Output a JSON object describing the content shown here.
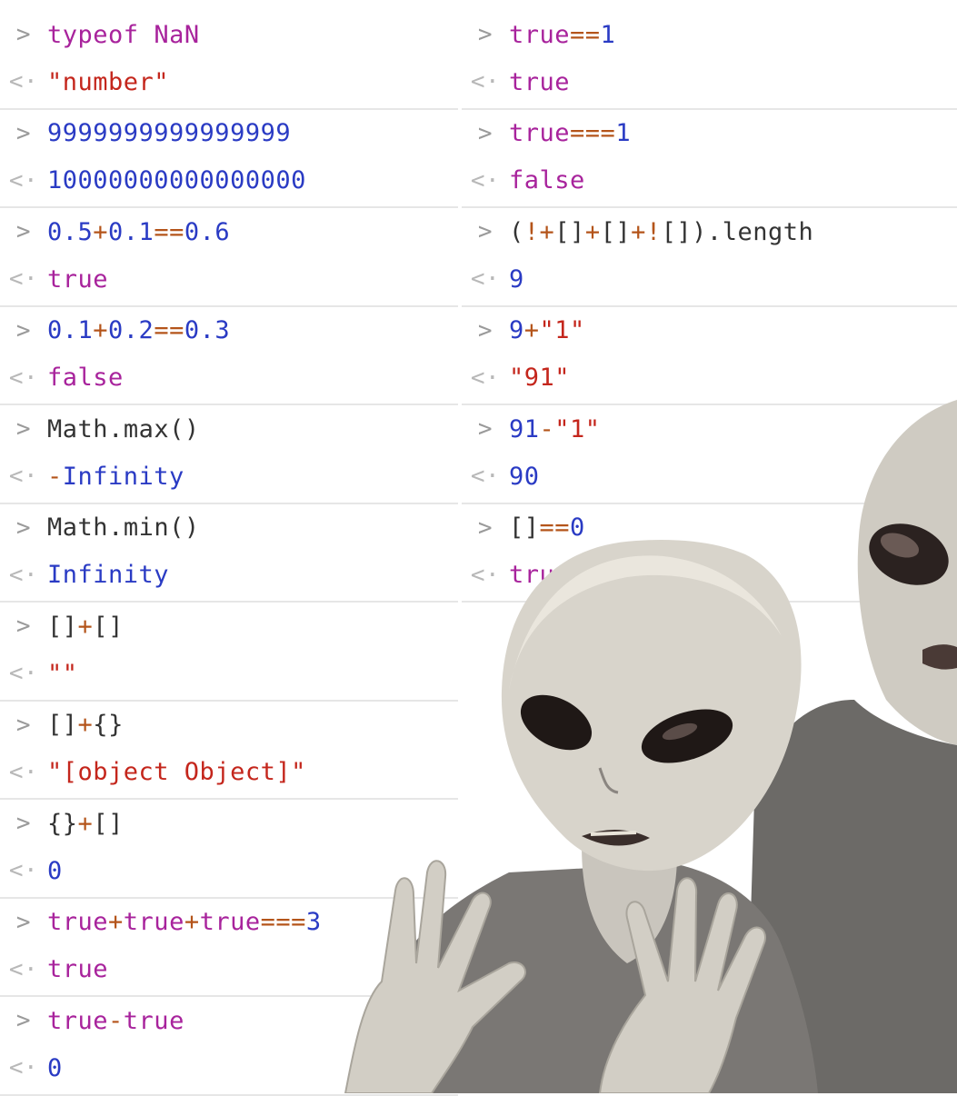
{
  "prompt_symbols": {
    "input": ">",
    "input_alt": "≥",
    "output": "<·"
  },
  "left": [
    {
      "input": "typeof NaN",
      "output": "\"number\""
    },
    {
      "input": "9999999999999999",
      "output": "10000000000000000"
    },
    {
      "input": "0.5+0.1==0.6",
      "output": "true"
    },
    {
      "input": "0.1+0.2==0.3",
      "output": "false"
    },
    {
      "input": "Math.max()",
      "output": "-Infinity"
    },
    {
      "input": "Math.min()",
      "output": "Infinity"
    },
    {
      "input": "[]+[]",
      "output": "\"\""
    },
    {
      "input": "[]+{}",
      "output": "\"[object Object]\""
    },
    {
      "input": "{}+[]",
      "output": "0"
    },
    {
      "input": "true+true+true===3",
      "output": "true"
    },
    {
      "input": "true-true",
      "output": "0"
    }
  ],
  "right": [
    {
      "input": "true==1",
      "output": "true"
    },
    {
      "input": "true===1",
      "output": "false"
    },
    {
      "input": "(!+[]+[]+![]).length",
      "output": "9"
    },
    {
      "input": "9+\"1\"",
      "output": "\"91\""
    },
    {
      "input": "91-\"1\"",
      "output": "90"
    },
    {
      "input": "[]==0",
      "output": "true"
    }
  ],
  "colors": {
    "keyword": "#a8239c",
    "number": "#2a3bc4",
    "operator": "#b4541a",
    "string": "#c4261c",
    "plain": "#333333",
    "separator": "#e6e6e6"
  }
}
